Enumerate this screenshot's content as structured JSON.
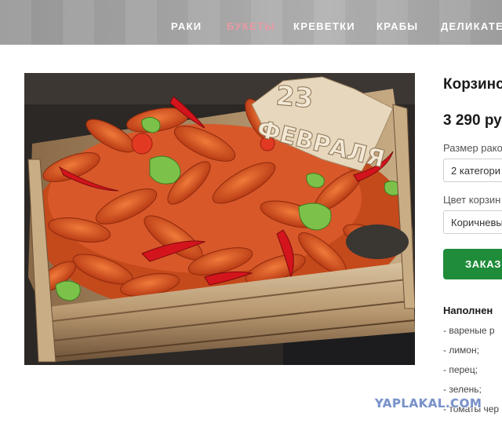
{
  "nav": {
    "items": [
      {
        "label": "РАКИ",
        "active": false
      },
      {
        "label": "БУКЕТЫ",
        "active": true
      },
      {
        "label": "КРЕВЕТКИ",
        "active": false
      },
      {
        "label": "КРАБЫ",
        "active": false
      },
      {
        "label": "ДЕЛИКАТЕ",
        "active": false
      }
    ],
    "active_color": "#e89aa4"
  },
  "photo": {
    "sign_number": "23",
    "sign_text": "ФЕВРАЛЯ"
  },
  "product": {
    "title": "Корзинс",
    "price": "3 290 ру",
    "size_label": "Размер рако",
    "size_value": "2 категори",
    "color_label": "Цвет корзин",
    "color_value": "Коричневы",
    "order_button": "ЗАКАЗ",
    "filling_title": "Наполнен",
    "filling_items": [
      "- вареные р",
      "- лимон;",
      "- перец;",
      "- зелень;",
      "- томаты чер"
    ]
  },
  "accent_green": "#1f8c3a",
  "watermark": "YAPLAKAL.COM"
}
